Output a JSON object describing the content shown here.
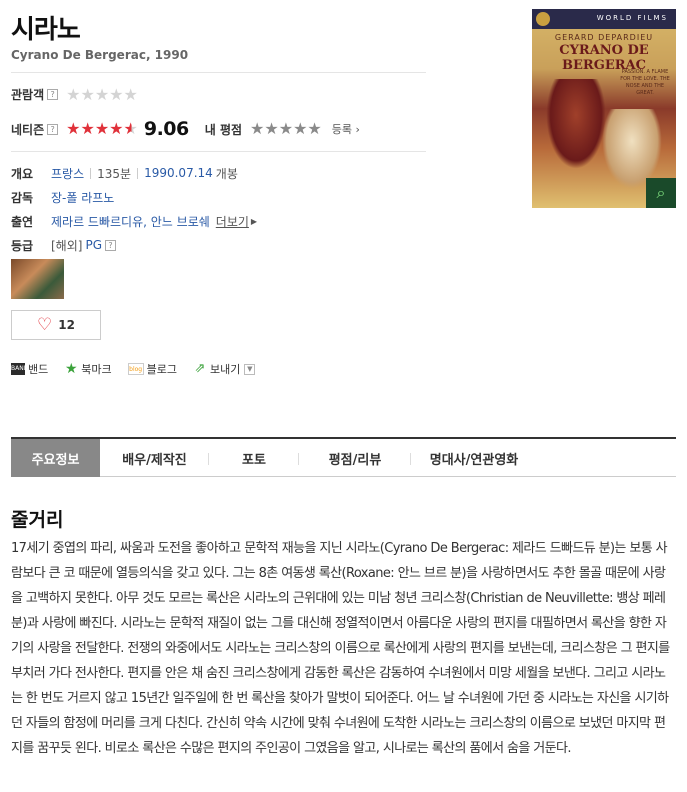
{
  "movie": {
    "title": "시라노",
    "subtitle": "Cyrano De Bergerac, 1990"
  },
  "ratings": {
    "audience_label": "관람객",
    "audience_stars": 0,
    "netizen_label": "네티즌",
    "netizen_score": "9.06",
    "netizen_stars": 4.5,
    "my_rating_label": "내 평점",
    "my_rating_stars": 0,
    "register_label": "등록",
    "help_glyph": "?"
  },
  "info": {
    "overview_label": "개요",
    "country": "프랑스",
    "runtime": "135분",
    "release_date": "1990.07.14",
    "release_suffix": "개봉",
    "director_label": "감독",
    "director": "장-폴 라프노",
    "cast_label": "출연",
    "cast": "제라르 드빠르디유, 안느 브로쉐",
    "cast_more": "더보기",
    "grade_label": "등급",
    "grade_prefix": "[해외]",
    "grade": "PG"
  },
  "like": {
    "count": "12"
  },
  "share": {
    "band": "밴드",
    "bookmark": "북마크",
    "blog": "블로그",
    "send": "보내기"
  },
  "poster": {
    "banner": "WORLD FILMS",
    "actor": "GERARD DEPARDIEU",
    "title": "CYRANO DE BERGERAC",
    "tagline": "PASSION. A FLAME FOR THE LOVE. THE NOSE AND THE GREAT."
  },
  "tabs": [
    {
      "label": "주요정보",
      "active": true
    },
    {
      "label": "배우/제작진",
      "active": false
    },
    {
      "label": "포토",
      "active": false
    },
    {
      "label": "평점/리뷰",
      "active": false
    },
    {
      "label": "명대사/연관영화",
      "active": false
    }
  ],
  "synopsis": {
    "title": "줄거리",
    "text": "17세기 중엽의 파리, 싸움과 도전을 좋아하고 문학적 재능을 지닌 시라노(Cyrano De Bergerac: 제라드 드빠드듀 분)는 보통 사람보다 큰 코 때문에 열등의식을 갖고 있다. 그는 8촌 여동생 록산(Roxane: 안느 브르 분)을 사랑하면서도 추한 몰골 때문에 사랑을 고백하지 못한다. 아무 것도 모르는 록산은 시라노의 근위대에 있는 미남 청년 크리스창(Christian de Neuvillette: 뱅상 페레 분)과 사랑에 빠진다. 시라노는 문학적 재질이 없는 그를 대신해 정열적이면서 아름다운 사랑의 편지를 대필하면서 록산을 향한 자기의 사랑을 전달한다. 전쟁의 와중에서도 시라노는 크리스창의 이름으로 록산에게 사랑의 편지를 보낸는데, 크리스창은 그 편지를 부치러 가다 전사한다. 편지를 안은 채 숨진 크리스창에게 감동한 록산은 감동하여 수녀원에서 미망 세월을 보낸다. 그리고 시라노는 한 번도 거르지 않고 15년간 일주일에 한 번 록산을 찾아가 말벗이 되어준다. 어느 날 수녀원에 가던 중 시라노는 자신을 시기하던 자들의 함정에 머리를 크게 다친다. 간신히 약속 시간에 맞춰 수녀원에 도착한 시라노는 크리스창의 이름으로 보냈던 마지막 편지를 꿈꾸듯 왼다. 비로소 록산은 수많은 편지의 주인공이 그였음을 알고, 시나로는 록산의 품에서 숨을 거둔다."
  },
  "colors": {
    "accent_red": "#e0313a",
    "link_blue": "#2a5aa6",
    "active_tab": "#888888"
  }
}
